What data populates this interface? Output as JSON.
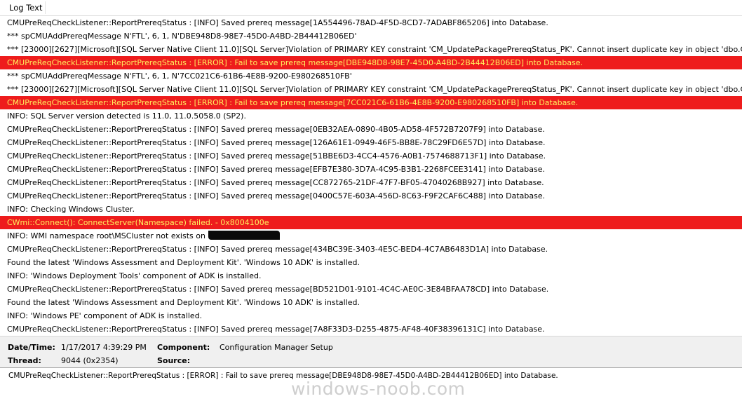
{
  "header": {
    "title": "Log Text"
  },
  "log_rows": [
    {
      "text": "CMUPreReqCheckListener::ReportPrereqStatus : [INFO] Saved prereq message[1A554496-78AD-4F5D-8CD7-7ADABF865206] into Database.",
      "error": false
    },
    {
      "text": "*** spCMUAddPrereqMessage N'FTL', 6, 1, N'DBE948D8-98E7-45D0-A4BD-2B44412B06ED'",
      "error": false
    },
    {
      "text": "*** [23000][2627][Microsoft][SQL Server Native Client 11.0][SQL Server]Violation of PRIMARY KEY constraint 'CM_UpdatePackagePrereqStatus_PK'. Cannot insert duplicate key in object 'dbo.CM_Updat",
      "error": false
    },
    {
      "text": "CMUPreReqCheckListener::ReportPrereqStatus : [ERROR] : Fail to save prereq message[DBE948D8-98E7-45D0-A4BD-2B44412B06ED] into Database.",
      "error": true
    },
    {
      "text": "*** spCMUAddPrereqMessage N'FTL', 6, 1, N'7CC021C6-61B6-4E8B-9200-E980268510FB'",
      "error": false
    },
    {
      "text": "*** [23000][2627][Microsoft][SQL Server Native Client 11.0][SQL Server]Violation of PRIMARY KEY constraint 'CM_UpdatePackagePrereqStatus_PK'. Cannot insert duplicate key in object 'dbo.CM_Updat",
      "error": false
    },
    {
      "text": "CMUPreReqCheckListener::ReportPrereqStatus : [ERROR] : Fail to save prereq message[7CC021C6-61B6-4E8B-9200-E980268510FB] into Database.",
      "error": true
    },
    {
      "text": "INFO: SQL Server version detected is 11.0, 11.0.5058.0 (SP2).",
      "error": false
    },
    {
      "text": "CMUPreReqCheckListener::ReportPrereqStatus : [INFO] Saved prereq message[0EB32AEA-0890-4B05-AD58-4F572B7207F9] into Database.",
      "error": false
    },
    {
      "text": "CMUPreReqCheckListener::ReportPrereqStatus : [INFO] Saved prereq message[126A61E1-0949-46F5-BB8E-78C29FD6E57D] into Database.",
      "error": false
    },
    {
      "text": "CMUPreReqCheckListener::ReportPrereqStatus : [INFO] Saved prereq message[51BBE6D3-4CC4-4576-A0B1-7574688713F1] into Database.",
      "error": false
    },
    {
      "text": "CMUPreReqCheckListener::ReportPrereqStatus : [INFO] Saved prereq message[EFB7E380-3D7A-4C95-B3B1-2268FCEE3141] into Database.",
      "error": false
    },
    {
      "text": "CMUPreReqCheckListener::ReportPrereqStatus : [INFO] Saved prereq message[CC872765-21DF-47F7-BF05-47040268B927] into Database.",
      "error": false
    },
    {
      "text": "CMUPreReqCheckListener::ReportPrereqStatus : [INFO] Saved prereq message[0400C57E-603A-456D-8C63-F9F2CAF6C488] into Database.",
      "error": false
    },
    {
      "text": "INFO: Checking Windows Cluster.",
      "error": false
    },
    {
      "text": "CWmi::Connect(): ConnectServer(Namespace) failed. - 0x8004100e",
      "error": true
    },
    {
      "text": "INFO: WMI namespace root\\MSCluster not exists on",
      "error": false,
      "redacted": true
    },
    {
      "text": "CMUPreReqCheckListener::ReportPrereqStatus : [INFO] Saved prereq message[434BC39E-3403-4E5C-BED4-4C7AB6483D1A] into Database.",
      "error": false
    },
    {
      "text": "Found the latest 'Windows Assessment and Deployment Kit'. 'Windows 10 ADK' is installed.",
      "error": false
    },
    {
      "text": "INFO: 'Windows Deployment Tools' component of ADK is installed.",
      "error": false
    },
    {
      "text": "CMUPreReqCheckListener::ReportPrereqStatus : [INFO] Saved prereq message[BD521D01-9101-4C4C-AE0C-3E84BFAA78CD] into Database.",
      "error": false
    },
    {
      "text": "Found the latest 'Windows Assessment and Deployment Kit'. 'Windows 10 ADK' is installed.",
      "error": false
    },
    {
      "text": "INFO: 'Windows PE' component of ADK is installed.",
      "error": false
    },
    {
      "text": "CMUPreReqCheckListener::ReportPrereqStatus : [INFO] Saved prereq message[7A8F33D3-D255-4875-AF48-40F38396131C] into Database.",
      "error": false
    }
  ],
  "details": {
    "datetime_label": "Date/Time:",
    "datetime_value": "1/17/2017 4:39:29 PM",
    "component_label": "Component:",
    "component_value": "Configuration Manager Setup",
    "thread_label": "Thread:",
    "thread_value": "9044 (0x2354)",
    "source_label": "Source:",
    "source_value": ""
  },
  "selected_text": "CMUPreReqCheckListener::ReportPrereqStatus : [ERROR] : Fail to save prereq message[DBE948D8-98E7-45D0-A4BD-2B44412B06ED] into Database.",
  "watermark": "windows-noob.com",
  "colors": {
    "error_bg": "#ee1c1c",
    "error_text": "#ffef5e",
    "details_bg": "#f0f0f0"
  }
}
